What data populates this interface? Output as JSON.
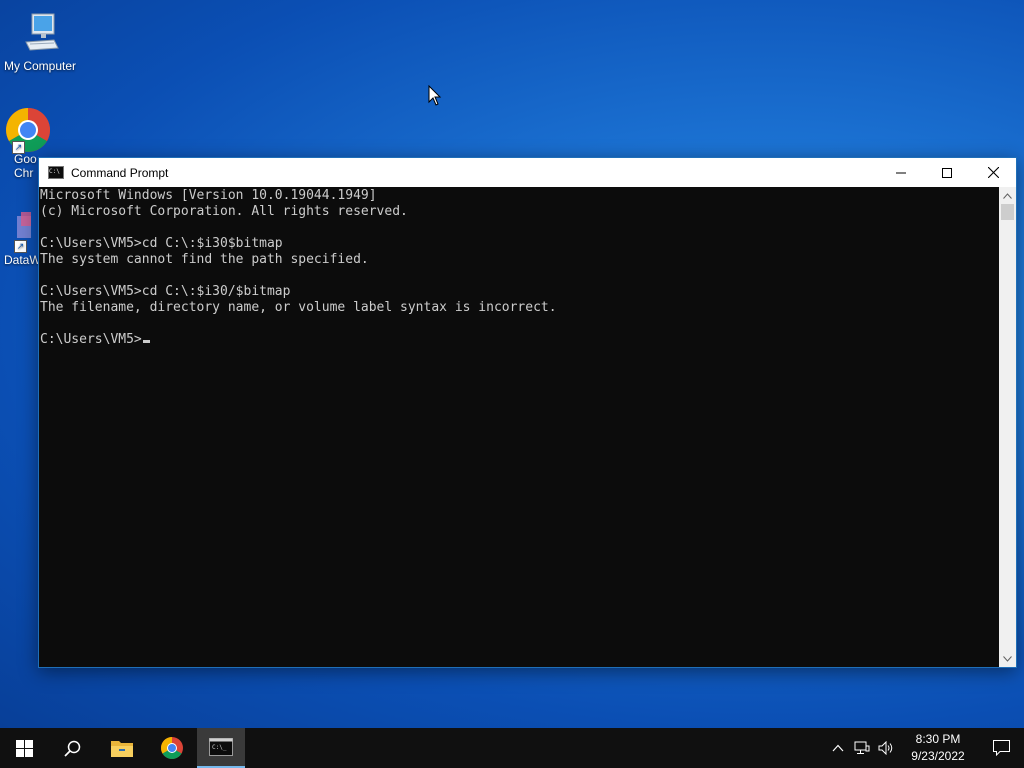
{
  "desktop": {
    "icons": [
      {
        "label": "My Computer"
      },
      {
        "label": "Goo\nChr"
      },
      {
        "label": "DataW"
      }
    ]
  },
  "window": {
    "title": "Command Prompt",
    "buttons": {
      "minimize": "minimize-icon",
      "maximize": "maximize-icon",
      "close": "close-icon"
    }
  },
  "terminal": {
    "lines": [
      "Microsoft Windows [Version 10.0.19044.1949]",
      "(c) Microsoft Corporation. All rights reserved.",
      "",
      "C:\\Users\\VM5>cd C:\\:$i30$bitmap",
      "The system cannot find the path specified.",
      "",
      "C:\\Users\\VM5>cd C:\\:$i30/$bitmap",
      "The filename, directory name, or volume label syntax is incorrect.",
      "",
      "C:\\Users\\VM5>"
    ]
  },
  "taskbar": {
    "start": "windows-logo-icon",
    "search": "search-icon",
    "apps": [
      "file-explorer-icon",
      "chrome-icon",
      "command-prompt-icon"
    ],
    "tray": [
      "chevron-up-icon",
      "network-icon",
      "volume-icon"
    ],
    "clock_time": "8:30 PM",
    "clock_date": "9/23/2022",
    "notification": "notification-icon"
  },
  "colors": {
    "desktop_bg": "#0b4fb4",
    "terminal_bg": "#0c0c0c",
    "terminal_fg": "#cccccc",
    "taskbar_bg": "#101010",
    "accent": "#76b9ed"
  }
}
